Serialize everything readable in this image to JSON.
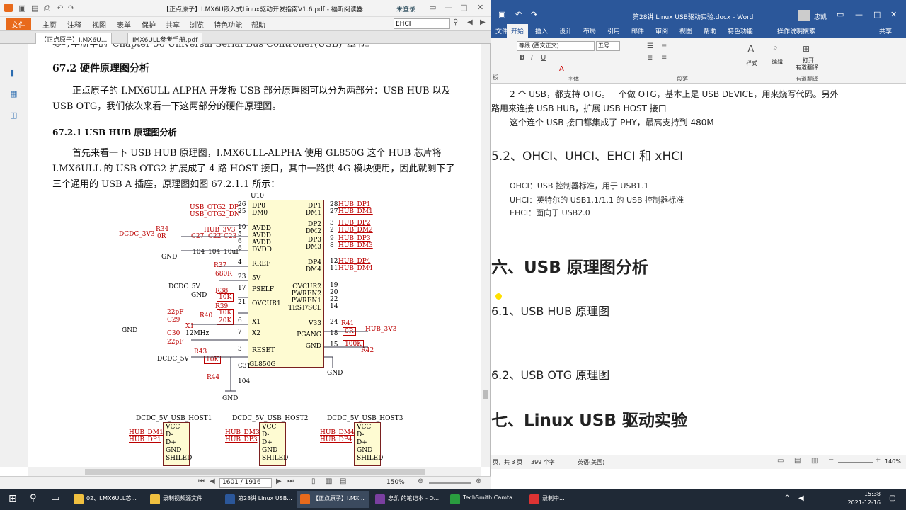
{
  "pdf": {
    "title": "【正点原子】I.MX6U嵌入式Linux驱动开发指南V1.6.pdf - 福昕阅读器",
    "login": "未登录",
    "search_value": "EHCI",
    "ribbon_file": "文件",
    "ribbon_tabs": [
      "主页",
      "注释",
      "视图",
      "表单",
      "保护",
      "共享",
      "浏览",
      "特色功能",
      "帮助"
    ],
    "doc_tabs": [
      "【正点原子】I.MX6U...",
      "IMX6ULL参考手册.pdf"
    ],
    "page_intro": "参考手册中的“Chapter 56 Universal Serial Bus Controller(USB)”章节。",
    "heading_672": "67.2  硬件原理图分析",
    "para1": "正点原子的 I.MX6ULL-ALPHA 开发板 USB 部分原理图可以分为两部分：USB HUB 以及",
    "para1b": "USB OTG，我们依次来看一下这两部分的硬件原理图。",
    "heading_6721": "67.2.1 USB HUB 原理图分析",
    "para2": "首先来看一下 USB HUB 原理图，I.MX6ULL-ALPHA 使用 GL850G 这个 HUB 芯片将",
    "para2b": "I.MX6ULL 的 USB OTG2 扩展成了 4 路 HOST 接口，其中一路供 4G 模块使用，因此就剩下了",
    "para2c": "三个通用的 USB A 插座，原理图如图 67.2.1.1 所示：",
    "schematic": {
      "chip_ref": "U10",
      "chip_name": "GL850G",
      "left_pins": [
        "DP0",
        "DM0",
        "AVDD",
        "AVDD",
        "AVDD",
        "DVDD",
        "RREF",
        "5V",
        "PSELF",
        "OVCUR1",
        "X1",
        "X2",
        "RESET"
      ],
      "left_nums": [
        "26",
        "25",
        "10",
        "5",
        "6",
        "6",
        "4",
        "23",
        "17",
        "21",
        "6",
        "7",
        "3"
      ],
      "right_pins": [
        "DP1",
        "DM1",
        "DP2",
        "DM2",
        "DP3",
        "DM3",
        "DP4",
        "DM4",
        "OVCUR2",
        "PWREN2",
        "PWREN1",
        "TEST/SCL",
        "V33",
        "PGANG",
        "GND"
      ],
      "right_nums": [
        "28",
        "27",
        "3",
        "2",
        "9",
        "8",
        "12",
        "11",
        "19",
        "20",
        "22",
        "14",
        "24",
        "18",
        "15"
      ],
      "left_nets": [
        "USB_OTG2_DP",
        "USB_OTG2_DN",
        "HUB_3V3",
        "DCDC_3V3",
        "GND",
        "DCDC_5V",
        "GND",
        "GND",
        "DCDC_5V"
      ],
      "right_nets": [
        "HUB_DP1",
        "HUB_DM1",
        "HUB_DP2",
        "HUB_DM2",
        "HUB_DP3",
        "HUB_DM3",
        "HUB_DP4",
        "HUB_DM4",
        "HUB_3V3",
        "GND"
      ],
      "parts": [
        "R34",
        "0R",
        "C27",
        "C22",
        "C23",
        "104",
        "104",
        "10uF",
        "R37",
        "680R",
        "R38",
        "10K",
        "R39",
        "10K",
        "R40",
        "20K",
        "22pF",
        "C29",
        "X1",
        "12MHz",
        "C30",
        "22pF",
        "R43",
        "10K",
        "R44",
        "C31",
        "104",
        "R41",
        "0R",
        "R42",
        "100K"
      ],
      "connectors": [
        {
          "title": "DCDC_5V_USB_HOST1",
          "nets": [
            "HUB_DM1",
            "HUB_DP1"
          ],
          "pins": [
            "VCC",
            "D-",
            "D+",
            "GND",
            "SHILED"
          ]
        },
        {
          "title": "DCDC_5V_USB_HOST2",
          "nets": [
            "HUB_DM3",
            "HUB_DP3"
          ],
          "pins": [
            "VCC",
            "D-",
            "D+",
            "GND",
            "SHILED"
          ]
        },
        {
          "title": "DCDC_5V_USB_HOST3",
          "nets": [
            "HUB_DM4",
            "HUB_DP4"
          ],
          "pins": [
            "VCC",
            "D-",
            "D+",
            "GND",
            "SHILED"
          ]
        }
      ]
    },
    "status_page": "1601 / 1916",
    "status_zoom": "150%"
  },
  "word": {
    "title": "第28讲 Linux USB驱动实验.docx - Word",
    "user": "忠凯",
    "tabs": [
      "文件",
      "开始",
      "插入",
      "设计",
      "布局",
      "引用",
      "邮件",
      "审阅",
      "视图",
      "帮助",
      "特色功能",
      "操作说明搜索",
      "共享"
    ],
    "font_name": "等线 (西文正文)",
    "font_size": "五号",
    "ribbon_groups": [
      "字体",
      "段落",
      "样式",
      "编辑",
      "打开有道翻译",
      "有道翻译"
    ],
    "ribbon_labels": {
      "styles": "样式",
      "edit": "编辑",
      "open_translate": "打开",
      "translate_line2": "有道翻译",
      "translate_group": "有道翻译",
      "font_group": "字体",
      "para_group": "段落",
      "clipboard_partial": "板"
    },
    "lines": {
      "l1": "2 个 USB，都支持 OTG。一个做 OTG，基本上是 USB DEVICE，用来烧写代码。另外一",
      "l2": "路用来连接 USB HUB，扩展 USB HOST 接口",
      "l3": "这个连个 USB 接口都集成了 PHY，最高支持到 480M",
      "h52": "5.2、OHCI、UHCI、EHCI 和 xHCI",
      "ohci": "OHCI：USB 控制器标准，用于 USB1.1",
      "uhci": "UHCI：英特尔的 USB1.1/1.1 的 USB 控制器标准",
      "ehci": "EHCI：面向于 USB2.0",
      "h6": "六、USB 原理图分析",
      "h61": "6.1、USB HUB 原理图",
      "h62": "6.2、USB OTG 原理图",
      "h7": "七、Linux USB 驱动实验"
    },
    "status_pages": "页，共 3 页",
    "status_words": "399 个字",
    "status_lang": "英语(美国)",
    "status_zoom": "140%"
  },
  "taskbar": {
    "items": [
      {
        "label": "02、I.MX6ULL芯...",
        "color": "#f0c040"
      },
      {
        "label": "录制视频源文件",
        "color": "#f0c040"
      },
      {
        "label": "第28讲 Linux USB...",
        "color": "#2b579a"
      },
      {
        "label": "【正点原子】I.MX...",
        "color": "#e86a1c"
      },
      {
        "label": "忠凯 的笔记本 - O...",
        "color": "#7a3fa0"
      },
      {
        "label": "TechSmith Camta...",
        "color": "#2a9d3f"
      },
      {
        "label": "录制中...",
        "color": "#d33"
      }
    ],
    "time": "15:38",
    "date": "2021-12-16"
  }
}
